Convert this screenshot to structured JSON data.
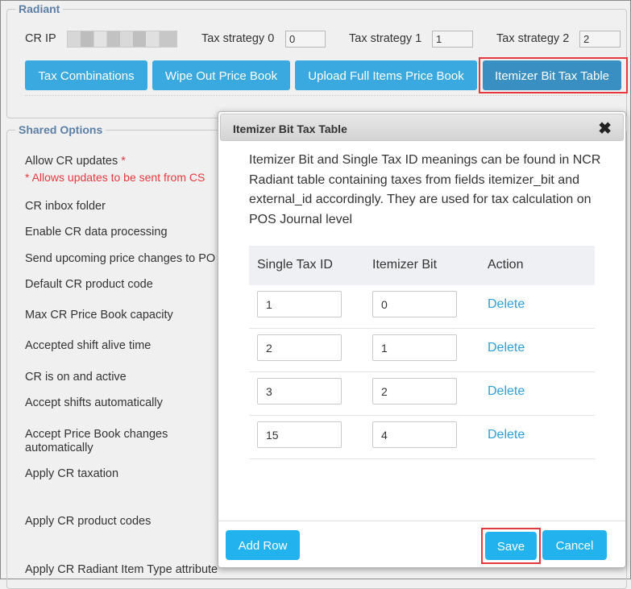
{
  "radiant": {
    "legend": "Radiant",
    "cr_ip_label": "CR IP",
    "tax_strategy_0_label": "Tax strategy 0",
    "tax_strategy_0_value": "0",
    "tax_strategy_1_label": "Tax strategy 1",
    "tax_strategy_1_value": "1",
    "tax_strategy_2_label": "Tax strategy 2",
    "tax_strategy_2_value": "2",
    "buttons": {
      "tax_combinations": "Tax Combinations",
      "wipe_out": "Wipe Out Price Book",
      "upload_full": "Upload Full Items Price Book",
      "itemizer": "Itemizer Bit Tax Table"
    }
  },
  "shared": {
    "legend": "Shared Options",
    "allow_cr_updates": "Allow CR updates",
    "required_mark": "*",
    "allow_note": "* Allows updates to be sent from CS",
    "cr_inbox": "CR inbox folder",
    "enable_cr_data": "Enable CR data processing",
    "send_upcoming": "Send upcoming price changes to PO",
    "default_code": "Default CR product code",
    "max_capacity": "Max CR Price Book capacity",
    "shift_alive": "Accepted shift alive time",
    "cr_on": "CR is on and active",
    "accept_shifts": "Accept shifts automatically",
    "accept_pb_line1": "Accept Price Book changes",
    "accept_pb_line2": "automatically",
    "apply_taxation": "Apply CR taxation",
    "apply_codes": "Apply CR product codes",
    "apply_item_type": "Apply CR Radiant Item Type attribute"
  },
  "modal": {
    "title": "Itemizer Bit Tax Table",
    "close": "✖",
    "description": "Itemizer Bit and Single Tax ID meanings can be found in NCR Radiant table containing taxes from fields itemizer_bit and external_id accordingly. They are used for tax calculation on POS Journal level",
    "headers": {
      "tax_id": "Single Tax ID",
      "itemizer": "Itemizer Bit",
      "action": "Action"
    },
    "rows": [
      {
        "tax_id": "1",
        "itemizer": "0",
        "action": "Delete"
      },
      {
        "tax_id": "2",
        "itemizer": "1",
        "action": "Delete"
      },
      {
        "tax_id": "3",
        "itemizer": "2",
        "action": "Delete"
      },
      {
        "tax_id": "15",
        "itemizer": "4",
        "action": "Delete"
      }
    ],
    "add_row": "Add Row",
    "save": "Save",
    "cancel": "Cancel"
  }
}
